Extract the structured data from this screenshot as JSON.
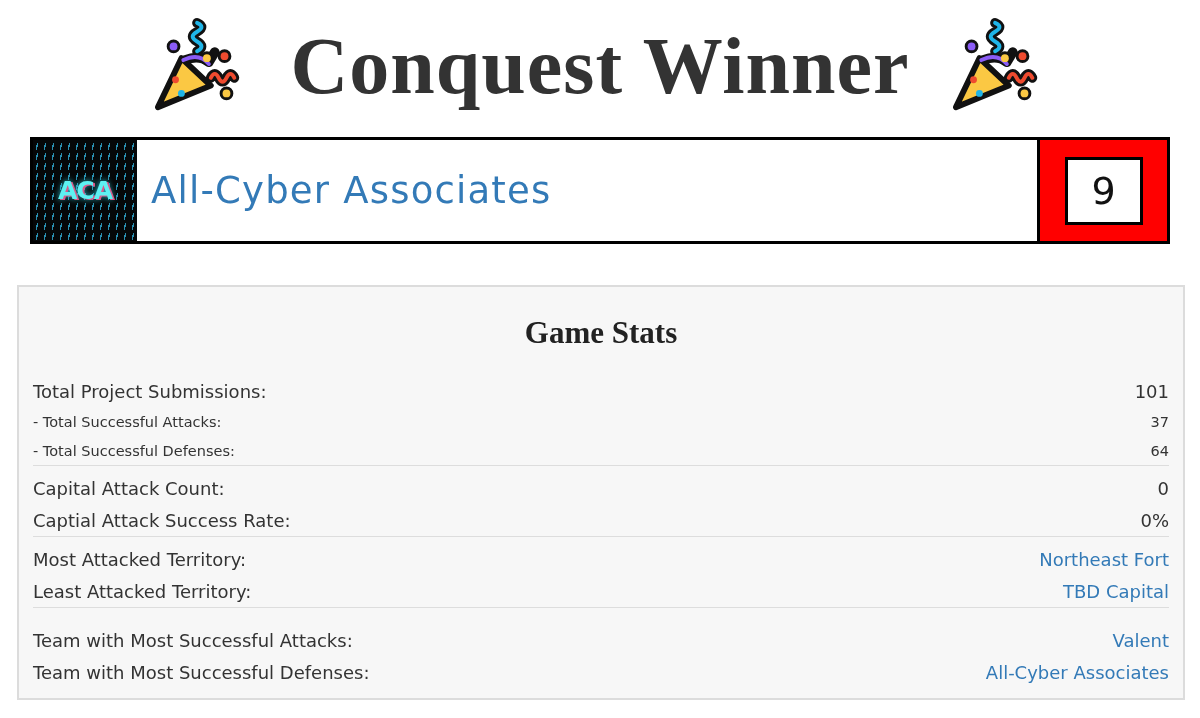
{
  "header": {
    "title": "Conquest Winner"
  },
  "winner": {
    "logo_text": "ACA",
    "name": "All-Cyber Associates",
    "score": "9"
  },
  "game_stats": {
    "title": "Game Stats",
    "groups": [
      {
        "rows": [
          {
            "kind": "main",
            "label": "Total Project Submissions:",
            "value": "101"
          },
          {
            "kind": "sub",
            "label": "- Total Successful Attacks:",
            "value": "37"
          },
          {
            "kind": "sub",
            "label": "- Total Successful Defenses:",
            "value": "64"
          }
        ]
      },
      {
        "rows": [
          {
            "kind": "main",
            "label": "Capital Attack Count:",
            "value": "0"
          },
          {
            "kind": "main",
            "label": "Captial Attack Success Rate:",
            "value": "0%"
          }
        ]
      },
      {
        "rows": [
          {
            "kind": "link",
            "label": "Most Attacked Territory:",
            "value": "Northeast Fort"
          },
          {
            "kind": "link",
            "label": "Least Attacked Territory:",
            "value": "TBD Capital"
          }
        ]
      },
      {
        "rows": [
          {
            "kind": "link",
            "label": "Team with Most Successful Attacks:",
            "value": "Valent"
          },
          {
            "kind": "link",
            "label": "Team with Most Successful Defenses:",
            "value": "All-Cyber Associates"
          }
        ]
      }
    ]
  }
}
